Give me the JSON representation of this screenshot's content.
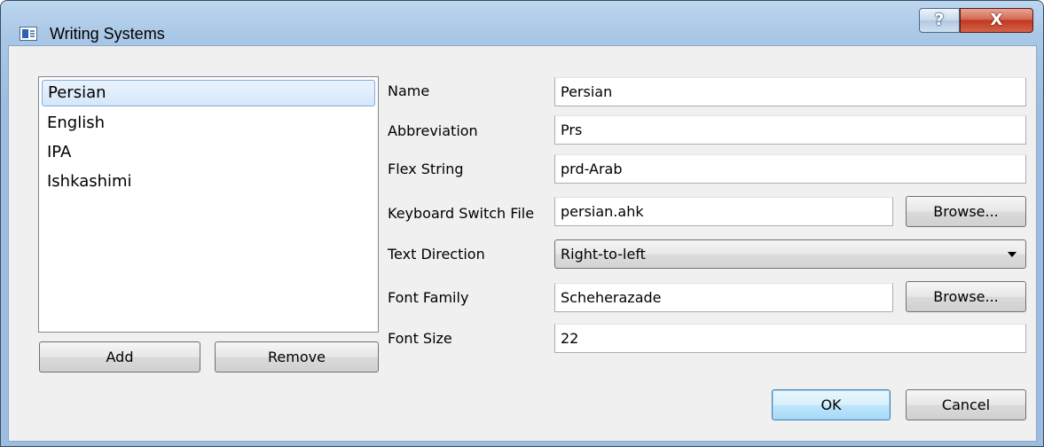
{
  "window": {
    "title": "Writing Systems",
    "help_label": "?",
    "close_label": "X"
  },
  "writing_systems": {
    "items": [
      {
        "label": "Persian",
        "selected": true
      },
      {
        "label": "English",
        "selected": false
      },
      {
        "label": "IPA",
        "selected": false
      },
      {
        "label": "Ishkashimi",
        "selected": false
      }
    ],
    "add_label": "Add",
    "remove_label": "Remove"
  },
  "form": {
    "name_label": "Name",
    "name_value": "Persian",
    "abbreviation_label": "Abbreviation",
    "abbreviation_value": "Prs",
    "flex_string_label": "Flex String",
    "flex_string_value": "prd-Arab",
    "keyboard_switch_label": "Keyboard Switch File",
    "keyboard_switch_value": "persian.ahk",
    "keyboard_browse_label": "Browse...",
    "text_direction_label": "Text Direction",
    "text_direction_value": "Right-to-left",
    "font_family_label": "Font Family",
    "font_family_value": "Scheherazade",
    "font_browse_label": "Browse...",
    "font_size_label": "Font Size",
    "font_size_value": "22"
  },
  "buttons": {
    "ok_label": "OK",
    "cancel_label": "Cancel"
  }
}
